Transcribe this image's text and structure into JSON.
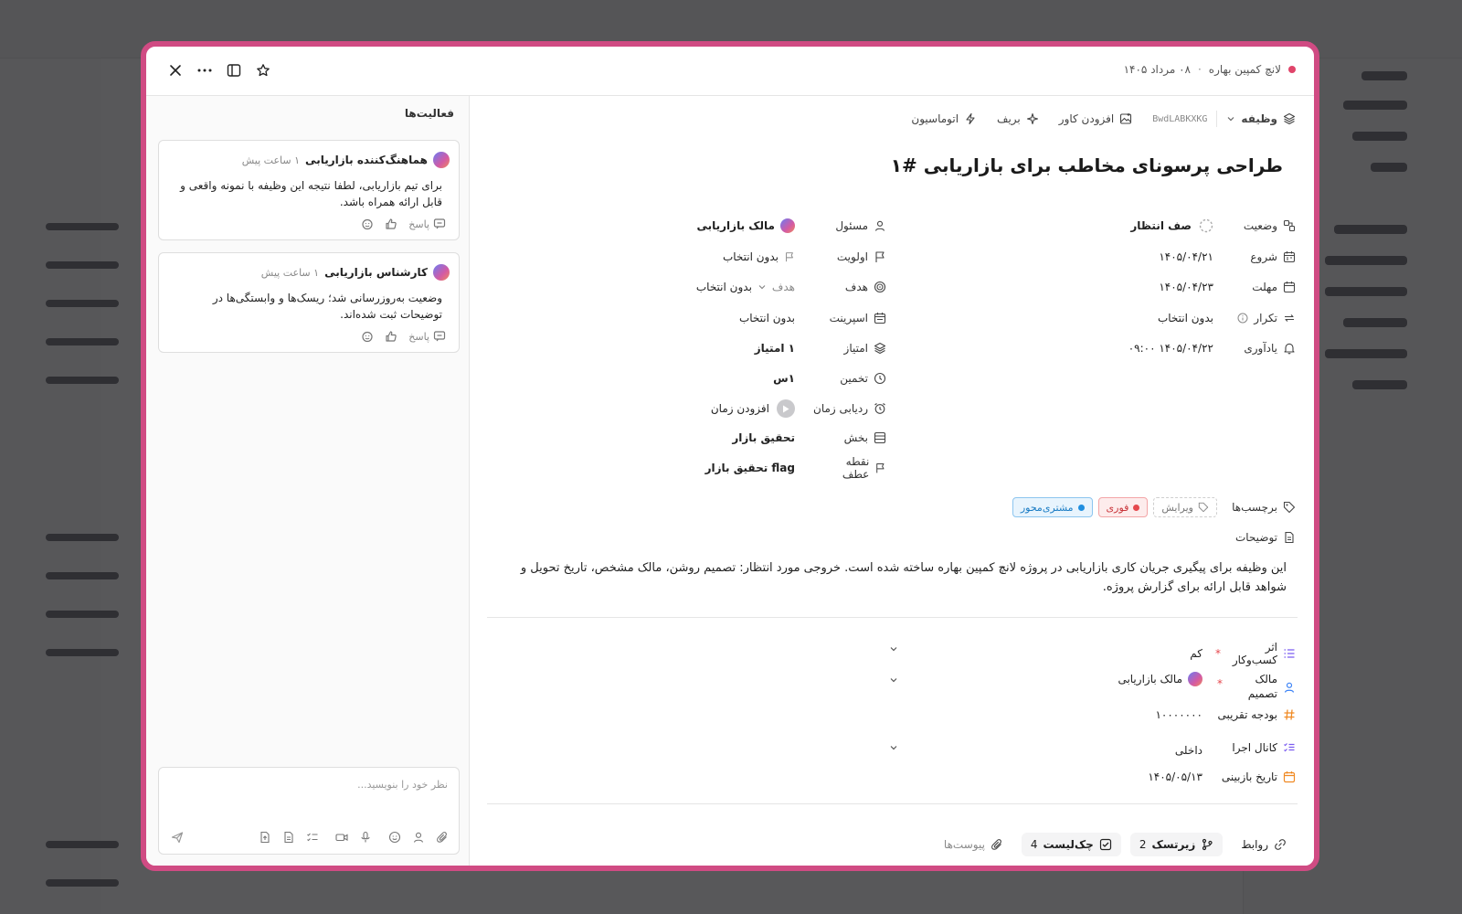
{
  "header": {
    "project": "لانچ کمپین بهاره",
    "separator": "·",
    "date": "۰۸ مرداد ۱۴۰۵"
  },
  "activity": {
    "title": "فعالیت‌ها",
    "comments": [
      {
        "author": "هماهنگ‌کننده بازاریابی",
        "time": "۱ ساعت پیش",
        "text": "برای تیم بازاریابی، لطفا نتیجه این وظیفه با نمونه واقعی و قابل ارائه همراه باشد.",
        "reply_label": "پاسخ"
      },
      {
        "author": "کارشناس بازاریابی",
        "time": "۱ ساعت پیش",
        "text": "وضعیت به‌روزرسانی شد؛ ریسک‌ها و وابستگی‌ها در توضیحات ثبت شده‌اند.",
        "reply_label": "پاسخ"
      }
    ],
    "composer_placeholder": "نظر خود را بنویسید..."
  },
  "toolbar": {
    "type_label": "وظیفه",
    "code": "BwdLABKXKG",
    "cover_label": "افزودن کاور",
    "brief_label": "بریف",
    "automation_label": "اتوماسیون"
  },
  "task": {
    "title": "طراحی پرسونای مخاطب برای بازاریابی #۱"
  },
  "props_right": {
    "status": {
      "label": "وضعیت",
      "value": "صف انتظار"
    },
    "start": {
      "label": "شروع",
      "value": "۱۴۰۵/۰۴/۲۱"
    },
    "due": {
      "label": "مهلت",
      "value": "۱۴۰۵/۰۴/۲۳"
    },
    "repeat": {
      "label": "تکرار",
      "value": "بدون انتخاب"
    },
    "reminder": {
      "label": "یادآوری",
      "value": "۱۴۰۵/۰۴/۲۲ ۰۹:۰۰"
    }
  },
  "props_left": {
    "assignee": {
      "label": "مسئول",
      "value": "مالک بازاریابی"
    },
    "priority": {
      "label": "اولویت",
      "value": "بدون انتخاب"
    },
    "goal": {
      "label": "هدف",
      "select": "هدف",
      "value": "بدون انتخاب"
    },
    "sprint": {
      "label": "اسپرینت",
      "value": "بدون انتخاب"
    },
    "points": {
      "label": "امتیاز",
      "value": "۱ امتیاز"
    },
    "estimate": {
      "label": "تخمین",
      "value": "۱س"
    },
    "time_tracking": {
      "label": "ردیابی زمان",
      "value": "افزودن زمان"
    },
    "section": {
      "label": "بخش",
      "value": "تحقیق بازار"
    },
    "milestone": {
      "label": "نقطه عطف",
      "value": "flag تحقیق بازار"
    }
  },
  "tags": {
    "label": "برچسب‌ها",
    "edit_label": "ویرایش",
    "items": [
      {
        "name": "فوری",
        "color": "#e5484d",
        "bg": "#fdecec",
        "border": "#f3a5a7"
      },
      {
        "name": "مشتری‌محور",
        "color": "#1f8fe0",
        "bg": "#e8f4fd",
        "border": "#8cc5ef"
      }
    ]
  },
  "description": {
    "label": "توضیحات",
    "text": "این وظیفه برای پیگیری جریان کاری بازاریابی در پروژه لانچ کمپین بهاره ساخته شده است. خروجی مورد انتظار: تصمیم روشن، مالک مشخص، تاریخ تحویل و شواهد قابل ارائه برای گزارش پروژه."
  },
  "custom_fields": {
    "business_impact": {
      "label": "اثر کسب‌وکار",
      "value": "کم",
      "required_mark": "*"
    },
    "decision_owner": {
      "label": "مالک تصمیم",
      "value": "مالک بازاریابی",
      "required_mark": "*"
    },
    "budget": {
      "label": "بودجه تقریبی",
      "value": "۱۰۰۰۰۰۰۰"
    },
    "channel": {
      "label": "کانال اجرا",
      "value": "داخلی"
    },
    "review_date": {
      "label": "تاریخ بازبینی",
      "value": "۱۴۰۵/۰۵/۱۳"
    }
  },
  "footer": {
    "relations_label": "روابط",
    "subtasks_label": "زیرتسک",
    "subtasks_count": "2",
    "checklist_label": "چک‌لیست",
    "checklist_count": "4",
    "attachments_label": "پیوست‌ها"
  },
  "colors": {
    "accent": "#d04b83",
    "purple_icon": "#7b5cf0",
    "orange_icon": "#f08a24"
  }
}
